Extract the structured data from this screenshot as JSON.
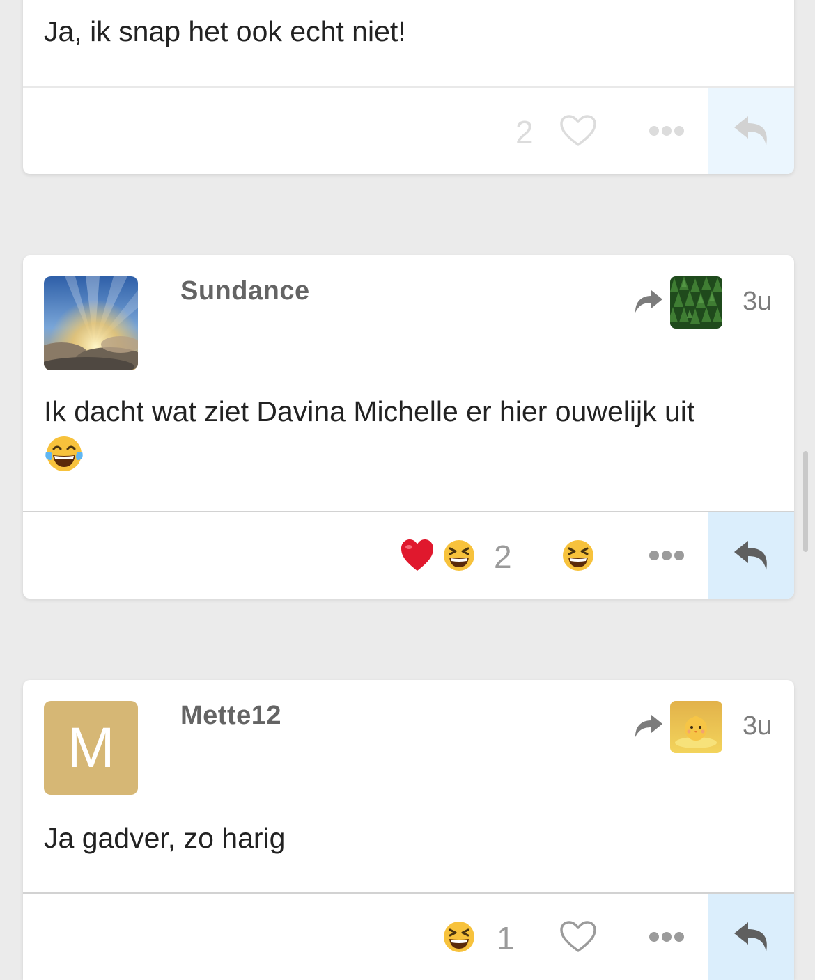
{
  "posts": [
    {
      "body": "Ja, ik snap het ook echt niet!",
      "likes": "2"
    },
    {
      "username": "Sundance",
      "age": "3u",
      "body": "Ik dacht wat ziet Davina Michelle er hier ouwelijk uit",
      "likes": "2",
      "reactions": [
        "heart-emoji",
        "grinning-squinting-emoji"
      ]
    },
    {
      "username": "Mette12",
      "avatar_letter": "M",
      "age": "3u",
      "body": "Ja gadver, zo harig",
      "likes": "1",
      "reactions": [
        "grinning-squinting-emoji"
      ]
    }
  ],
  "colors": {
    "page_bg": "#ebebeb",
    "reply_button_bg": "#dbeefc",
    "letter_avatar_bg": "#d6b775"
  }
}
